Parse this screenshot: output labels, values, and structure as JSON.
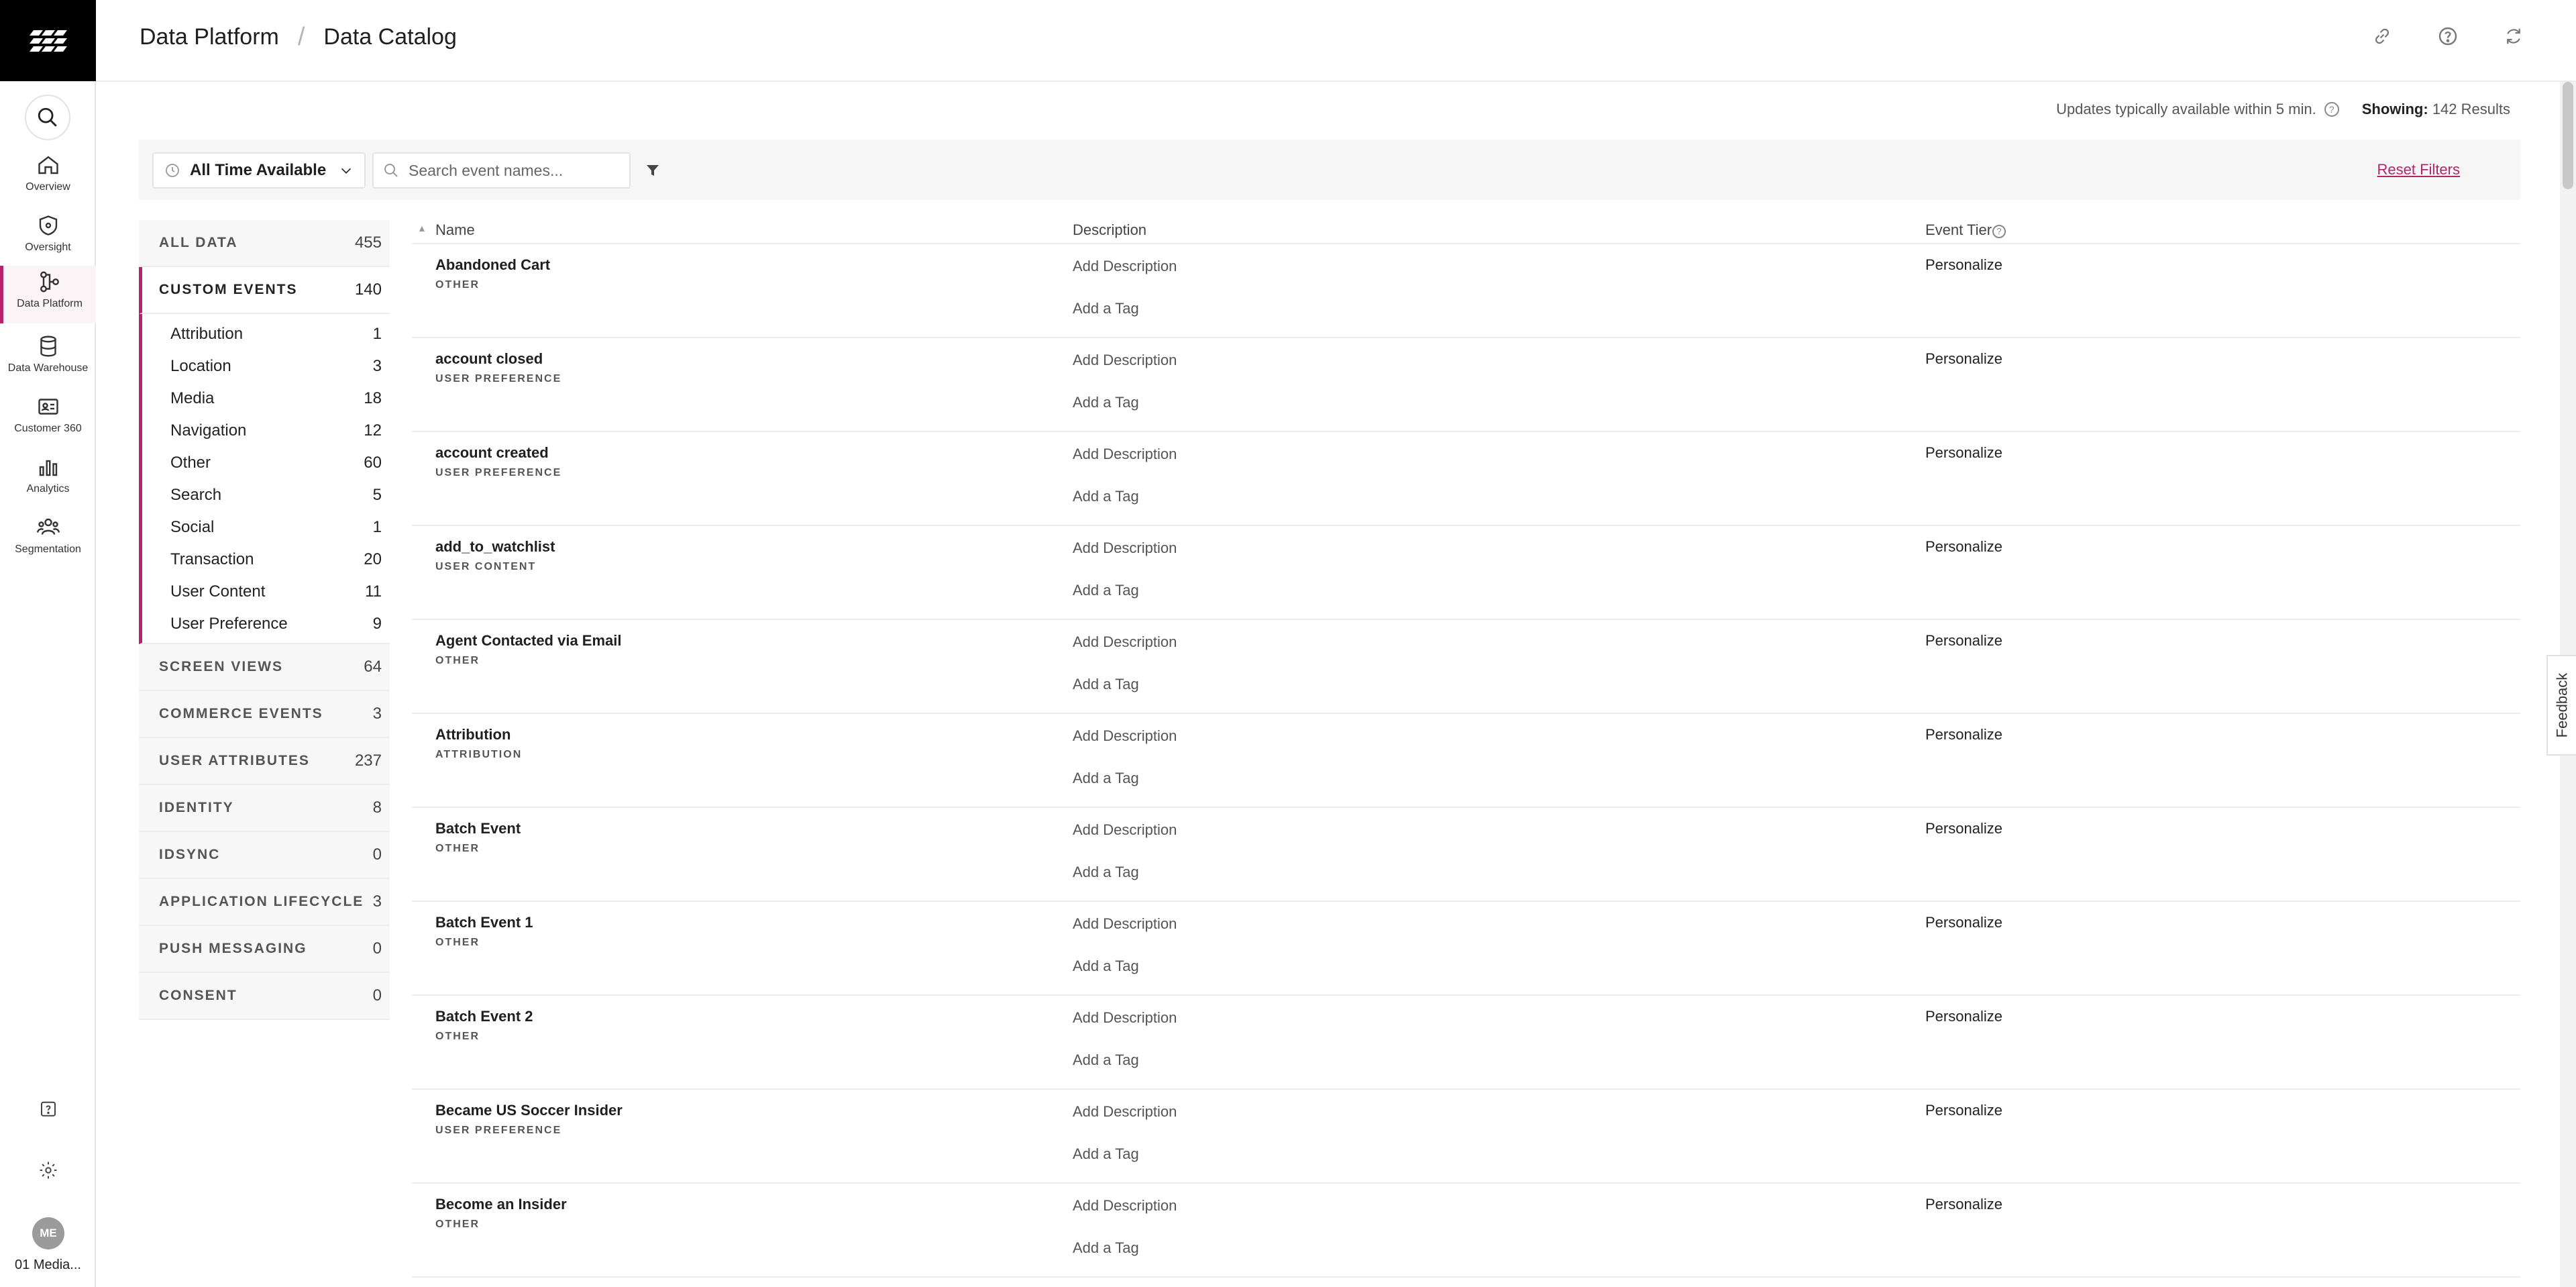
{
  "header": {
    "breadcrumb_parent": "Data Platform",
    "breadcrumb_sep": "/",
    "breadcrumb_current": "Data Catalog"
  },
  "rail": {
    "items": [
      {
        "label": "Overview",
        "icon": "home-icon"
      },
      {
        "label": "Oversight",
        "icon": "shield-icon"
      },
      {
        "label": "Data Platform",
        "icon": "data-platform-icon",
        "active": true
      },
      {
        "label": "Data Warehouse",
        "icon": "database-icon"
      },
      {
        "label": "Customer 360",
        "icon": "id-card-icon"
      },
      {
        "label": "Analytics",
        "icon": "bar-chart-icon"
      },
      {
        "label": "Segmentation",
        "icon": "people-icon"
      }
    ],
    "avatar_initials": "ME",
    "account_name": "01 Media..."
  },
  "info": {
    "updates_text": "Updates typically available within 5 min.",
    "showing_label": "Showing:",
    "showing_value": "142 Results"
  },
  "filters": {
    "time_range": "All Time Available",
    "search_placeholder": "Search event names...",
    "reset_label": "Reset Filters"
  },
  "categories": {
    "all_data": {
      "label": "ALL DATA",
      "count": "455"
    },
    "custom_events": {
      "label": "CUSTOM EVENTS",
      "count": "140"
    },
    "custom_sub": [
      {
        "label": "Attribution",
        "count": "1"
      },
      {
        "label": "Location",
        "count": "3"
      },
      {
        "label": "Media",
        "count": "18"
      },
      {
        "label": "Navigation",
        "count": "12"
      },
      {
        "label": "Other",
        "count": "60"
      },
      {
        "label": "Search",
        "count": "5"
      },
      {
        "label": "Social",
        "count": "1"
      },
      {
        "label": "Transaction",
        "count": "20"
      },
      {
        "label": "User Content",
        "count": "11"
      },
      {
        "label": "User Preference",
        "count": "9"
      }
    ],
    "others": [
      {
        "label": "SCREEN VIEWS",
        "count": "64"
      },
      {
        "label": "COMMERCE EVENTS",
        "count": "3"
      },
      {
        "label": "USER ATTRIBUTES",
        "count": "237"
      },
      {
        "label": "IDENTITY",
        "count": "8"
      },
      {
        "label": "IDSYNC",
        "count": "0"
      },
      {
        "label": "APPLICATION LIFECYCLE",
        "count": "3"
      },
      {
        "label": "PUSH MESSAGING",
        "count": "0"
      },
      {
        "label": "CONSENT",
        "count": "0"
      }
    ]
  },
  "table": {
    "col_name": "Name",
    "col_description": "Description",
    "col_tier": "Event Tier",
    "add_description": "Add Description",
    "add_tag": "Add a Tag",
    "rows": [
      {
        "name": "Abandoned Cart",
        "category": "OTHER",
        "tier": "Personalize"
      },
      {
        "name": "account closed",
        "category": "USER PREFERENCE",
        "tier": "Personalize"
      },
      {
        "name": "account created",
        "category": "USER PREFERENCE",
        "tier": "Personalize"
      },
      {
        "name": "add_to_watchlist",
        "category": "USER CONTENT",
        "tier": "Personalize"
      },
      {
        "name": "Agent Contacted via Email",
        "category": "OTHER",
        "tier": "Personalize"
      },
      {
        "name": "Attribution",
        "category": "ATTRIBUTION",
        "tier": "Personalize"
      },
      {
        "name": "Batch Event",
        "category": "OTHER",
        "tier": "Personalize"
      },
      {
        "name": "Batch Event 1",
        "category": "OTHER",
        "tier": "Personalize"
      },
      {
        "name": "Batch Event 2",
        "category": "OTHER",
        "tier": "Personalize"
      },
      {
        "name": "Became US Soccer Insider",
        "category": "USER PREFERENCE",
        "tier": "Personalize"
      },
      {
        "name": "Become an Insider",
        "category": "OTHER",
        "tier": "Personalize"
      }
    ]
  },
  "feedback_label": "Feedback",
  "colors": {
    "accent": "#b4236b",
    "logo_bg": "#000000"
  }
}
